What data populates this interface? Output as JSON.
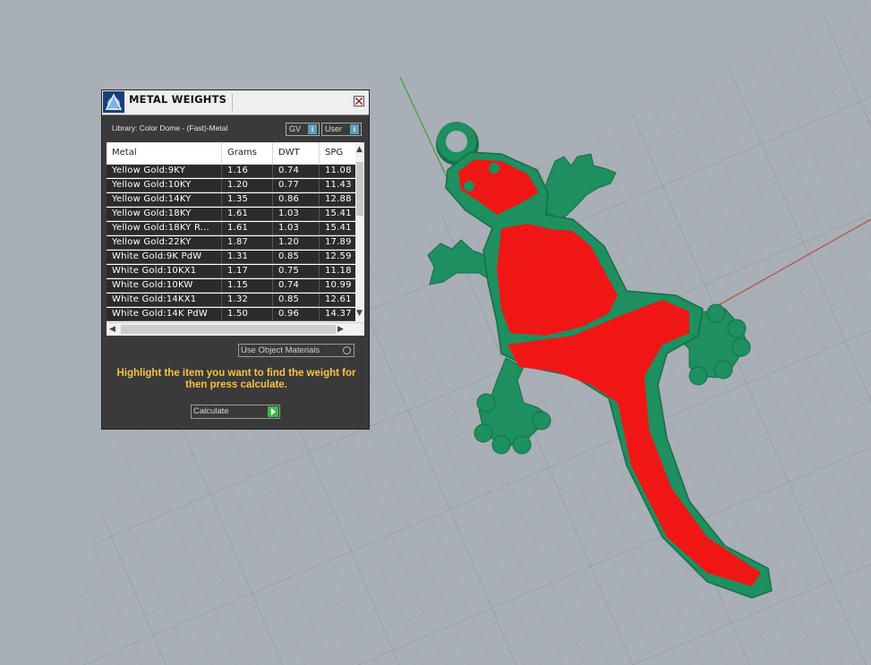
{
  "dialog": {
    "title": "METAL WEIGHTS",
    "library": "Library: Color Dome - (Fast)-Metal",
    "gv_label": "GV",
    "user_label": "User",
    "use_object_materials": "Use Object Materials",
    "hint": "Highlight the item you want to find the weight for then press calculate.",
    "calculate_label": "Calculate"
  },
  "table": {
    "columns": [
      "Metal",
      "Grams",
      "DWT",
      "SPG"
    ],
    "rows": [
      [
        "Yellow Gold:9KY",
        "1.16",
        "0.74",
        "11.08"
      ],
      [
        "Yellow Gold:10KY",
        "1.20",
        "0.77",
        "11.43"
      ],
      [
        "Yellow Gold:14KY",
        "1.35",
        "0.86",
        "12.88"
      ],
      [
        "Yellow Gold:18KY",
        "1.61",
        "1.03",
        "15.41"
      ],
      [
        "Yellow Gold:18KY R...",
        "1.61",
        "1.03",
        "15.41"
      ],
      [
        "Yellow Gold:22KY",
        "1.87",
        "1.20",
        "17.89"
      ],
      [
        "White Gold:9K PdW",
        "1.31",
        "0.85",
        "12.59"
      ],
      [
        "White Gold:10KX1",
        "1.17",
        "0.75",
        "11.18"
      ],
      [
        "White Gold:10KW",
        "1.15",
        "0.74",
        "10.99"
      ],
      [
        "White Gold:14KX1",
        "1.32",
        "0.85",
        "12.61"
      ],
      [
        "White Gold:14K PdW",
        "1.50",
        "0.96",
        "14.37"
      ]
    ]
  },
  "colors": {
    "viewport_bg": "#a9afb6",
    "gecko_green": "#1e8f5e",
    "gecko_red": "#f11616",
    "hint_yellow": "#f5c443",
    "axis_green": "#3f9f3a",
    "axis_red": "#b84c4c"
  },
  "icons": [
    "app-logo-icon",
    "close-icon",
    "info-icon",
    "scroll-up-icon",
    "scroll-down-icon",
    "scroll-left-icon",
    "scroll-right-icon",
    "play-icon"
  ]
}
